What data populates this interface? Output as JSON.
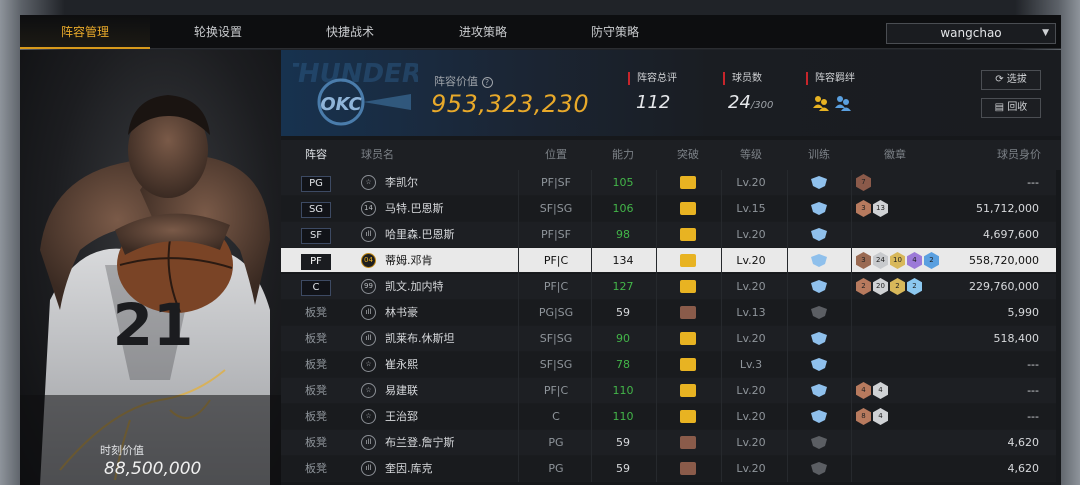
{
  "tabs": [
    "阵容管理",
    "轮换设置",
    "快捷战术",
    "进攻策略",
    "防守策略"
  ],
  "active_tab": 0,
  "user": {
    "name": "wangchao"
  },
  "left_panel": {
    "moment_value_label": "时刻价值",
    "moment_value": "88,500,000",
    "jersey_number": "21"
  },
  "header": {
    "lineup_value_label": "阵容价值",
    "lineup_value": "953,323,230",
    "stats": [
      {
        "label": "阵容总评",
        "value": "112"
      },
      {
        "label": "球员数",
        "value": "24",
        "suffix": "/300"
      },
      {
        "label": "阵容羁绊",
        "value": ""
      }
    ],
    "buttons": [
      "选拔",
      "回收"
    ],
    "logo_text": "OKC"
  },
  "columns": [
    "阵容",
    "球员名",
    "位置",
    "能力",
    "突破",
    "等级",
    "训练",
    "徽章",
    "球员身价"
  ],
  "colors": {
    "accent": "#e8a92a",
    "green": "#43b549",
    "red": "#c8252b"
  },
  "players": [
    {
      "slot": "PG",
      "starter": true,
      "icon": "star",
      "num": "",
      "name": "李凯尔",
      "pos": "PF|SF",
      "ability": "105",
      "green": true,
      "break": "gold",
      "level": "Lv.20",
      "train": "blue",
      "badges": [
        "7"
      ],
      "badge_colors": [
        "#8b5a4a"
      ],
      "value": "---"
    },
    {
      "slot": "SG",
      "starter": true,
      "icon": "num",
      "num": "14",
      "name": "马特.巴恩斯",
      "pos": "SF|SG",
      "ability": "106",
      "green": true,
      "break": "gold",
      "level": "Lv.15",
      "train": "blue",
      "badges": [
        "3",
        "13"
      ],
      "badge_colors": [
        "#b77a5e",
        "#d0d2d5"
      ],
      "value": "51,712,000"
    },
    {
      "slot": "SF",
      "starter": true,
      "icon": "bars",
      "num": "",
      "name": "哈里森.巴恩斯",
      "pos": "PF|SF",
      "ability": "98",
      "green": true,
      "break": "gold",
      "level": "Lv.20",
      "train": "blue",
      "badges": [],
      "badge_colors": [],
      "value": "4,697,600"
    },
    {
      "slot": "PF",
      "starter": true,
      "icon": "num",
      "num": "04",
      "name": "蒂姆.邓肯",
      "pos": "PF|C",
      "ability": "134",
      "green": false,
      "break": "gold",
      "level": "Lv.20",
      "train": "blue",
      "badges": [
        "3",
        "24",
        "10",
        "4",
        "2"
      ],
      "badge_colors": [
        "#9a6a52",
        "#c8cacd",
        "#d8b85a",
        "#9c7ad8",
        "#5aa0e0"
      ],
      "value": "558,720,000",
      "selected": true
    },
    {
      "slot": "C",
      "starter": true,
      "icon": "num",
      "num": "99",
      "name": "凯文.加内特",
      "pos": "PF|C",
      "ability": "127",
      "green": true,
      "break": "gold",
      "level": "Lv.20",
      "train": "blue",
      "badges": [
        "2",
        "20",
        "2",
        "2"
      ],
      "badge_colors": [
        "#b77a5e",
        "#d0d2d5",
        "#d8b85a",
        "#8cc8f0"
      ],
      "value": "229,760,000"
    },
    {
      "slot": "板凳",
      "starter": false,
      "icon": "bars",
      "num": "",
      "name": "林书豪",
      "pos": "PG|SG",
      "ability": "59",
      "green": false,
      "break": "brown",
      "level": "Lv.13",
      "train": "grey",
      "badges": [],
      "badge_colors": [],
      "value": "5,990"
    },
    {
      "slot": "板凳",
      "starter": false,
      "icon": "bars",
      "num": "",
      "name": "凯莱布.休斯坦",
      "pos": "SF|SG",
      "ability": "90",
      "green": true,
      "break": "gold",
      "level": "Lv.20",
      "train": "blue",
      "badges": [],
      "badge_colors": [],
      "value": "518,400"
    },
    {
      "slot": "板凳",
      "starter": false,
      "icon": "star",
      "num": "",
      "name": "崔永熙",
      "pos": "SF|SG",
      "ability": "78",
      "green": true,
      "break": "gold",
      "level": "Lv.3",
      "train": "blue",
      "badges": [],
      "badge_colors": [],
      "value": "---"
    },
    {
      "slot": "板凳",
      "starter": false,
      "icon": "star",
      "num": "",
      "name": "易建联",
      "pos": "PF|C",
      "ability": "110",
      "green": true,
      "break": "gold",
      "level": "Lv.20",
      "train": "blue",
      "badges": [
        "4",
        "4"
      ],
      "badge_colors": [
        "#b77a5e",
        "#d0d2d5"
      ],
      "value": "---"
    },
    {
      "slot": "板凳",
      "starter": false,
      "icon": "star",
      "num": "",
      "name": "王治郅",
      "pos": "C",
      "ability": "110",
      "green": true,
      "break": "gold",
      "level": "Lv.20",
      "train": "blue",
      "badges": [
        "8",
        "4"
      ],
      "badge_colors": [
        "#b77a5e",
        "#d0d2d5"
      ],
      "value": "---"
    },
    {
      "slot": "板凳",
      "starter": false,
      "icon": "bars",
      "num": "",
      "name": "布兰登.詹宁斯",
      "pos": "PG",
      "ability": "59",
      "green": false,
      "break": "brown",
      "level": "Lv.20",
      "train": "grey",
      "badges": [],
      "badge_colors": [],
      "value": "4,620"
    },
    {
      "slot": "板凳",
      "starter": false,
      "icon": "bars",
      "num": "",
      "name": "奎因.库克",
      "pos": "PG",
      "ability": "59",
      "green": false,
      "break": "brown",
      "level": "Lv.20",
      "train": "grey",
      "badges": [],
      "badge_colors": [],
      "value": "4,620"
    }
  ]
}
